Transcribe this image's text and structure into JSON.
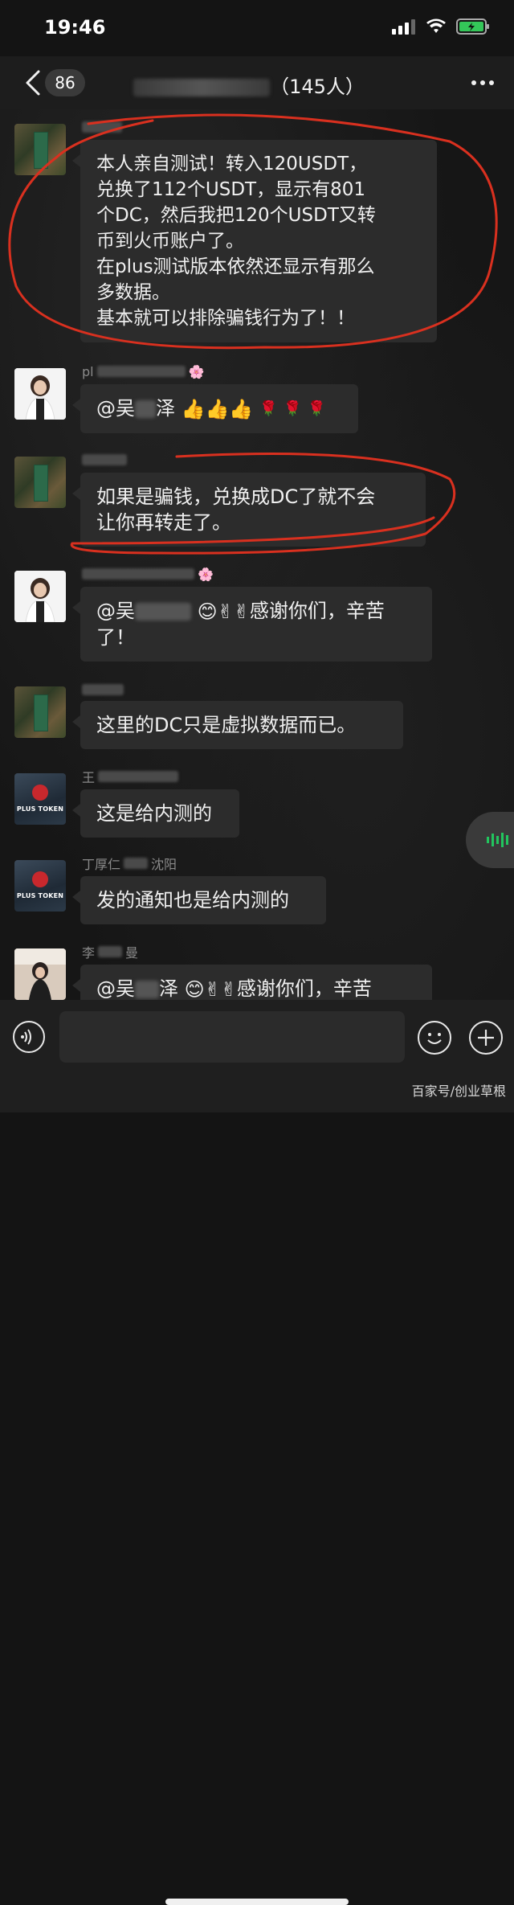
{
  "status_bar": {
    "time": "19:46"
  },
  "nav": {
    "unread_count": "86",
    "title_suffix": "（145人）"
  },
  "messages": [
    {
      "avatar": "forest-avatar",
      "text_lines": [
        "本人亲自测试！转入120USDT，",
        "兑换了112个USDT，显示有801",
        "个DC，然后我把120个USDT又转",
        "币到火币账户了。",
        "在plus测试版本依然还显示有那么",
        "多数据。",
        "基本就可以排除骗钱行为了！！"
      ]
    },
    {
      "avatar": "woman-avatar",
      "sender_prefix": "pl",
      "mention_prefix": "@吴",
      "mention_suffix": "泽",
      "emoji": [
        "👍",
        "👍",
        "👍",
        "🌹",
        "🌹",
        "🌹"
      ]
    },
    {
      "avatar": "forest-avatar",
      "text_lines": [
        "如果是骗钱，兑换成DC了就不会",
        "让你再转走了。"
      ]
    },
    {
      "avatar": "woman-avatar",
      "mention_prefix": "@吴",
      "emoji": [
        "😊",
        "✌",
        "✌"
      ],
      "text_after": "感谢你们，辛苦",
      "text_line2": "了！"
    },
    {
      "avatar": "forest-avatar",
      "text": "这里的DC只是虚拟数据而已。"
    },
    {
      "avatar": "plus-token-avatar",
      "avatar_label": "PLUS TOKEN",
      "sender_prefix": "王",
      "text": "这是给内测的"
    },
    {
      "avatar": "plus-token-avatar",
      "avatar_label": "PLUS TOKEN",
      "sender_prefix": "丁厚仁",
      "sender_suffix": "沈阳",
      "text": "发的通知也是给内测的"
    },
    {
      "avatar": "girl-avatar",
      "sender_prefix": "李",
      "sender_suffix": "曼",
      "mention_prefix": "@吴",
      "mention_suffix": "泽",
      "emoji": [
        "😊",
        "✌",
        "✌"
      ],
      "text_after": "感谢你们，辛苦"
    }
  ],
  "input": {
    "placeholder": ""
  },
  "watermark": "百家号/创业草根",
  "colors": {
    "accent_red": "#d9301f",
    "voice_green": "#22c55e"
  }
}
